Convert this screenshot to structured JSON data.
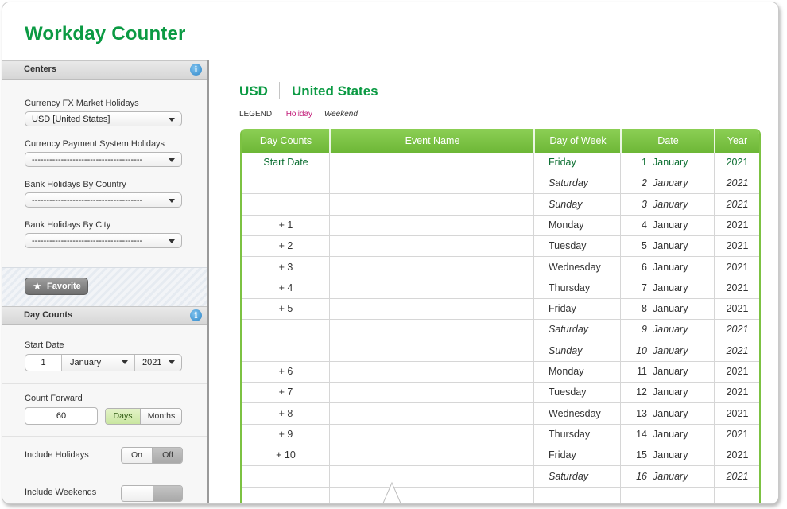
{
  "app": {
    "title": "Workday Counter"
  },
  "centers": {
    "title": "Centers",
    "info": "i",
    "fields": [
      {
        "label": "Currency FX Market Holidays",
        "value": "USD [United States]"
      },
      {
        "label": "Currency Payment System Holidays",
        "value": "--------------------------------------"
      },
      {
        "label": "Bank Holidays By Country",
        "value": "--------------------------------------"
      },
      {
        "label": "Bank Holidays By City",
        "value": "--------------------------------------"
      }
    ],
    "favorite_label": "Favorite"
  },
  "day_counts": {
    "title": "Day Counts",
    "info": "i",
    "start_date_label": "Start Date",
    "start_day": "1",
    "start_month": "January",
    "start_year": "2021",
    "count_forward_label": "Count Forward",
    "count_forward_value": "60",
    "unit_days": "Days",
    "unit_months": "Months",
    "include_holidays_label": "Include Holidays",
    "include_holidays_on": "On",
    "include_holidays_off": "Off",
    "include_weekends_label": "Include Weekends"
  },
  "main": {
    "currency_code": "USD",
    "currency_name": "United States",
    "legend_label": "LEGEND:",
    "legend_holiday": "Holiday",
    "legend_weekend": "Weekend",
    "columns": [
      "Day Counts",
      "Event Name",
      "Day of Week",
      "Date",
      "Year"
    ],
    "rows": [
      {
        "count": "Start Date",
        "event": "",
        "dow": "Friday",
        "day": "1",
        "month": "January",
        "year": "2021",
        "weekend": false,
        "start": true
      },
      {
        "count": "",
        "event": "",
        "dow": "Saturday",
        "day": "2",
        "month": "January",
        "year": "2021",
        "weekend": true
      },
      {
        "count": "",
        "event": "",
        "dow": "Sunday",
        "day": "3",
        "month": "January",
        "year": "2021",
        "weekend": true
      },
      {
        "count": "+ 1",
        "event": "",
        "dow": "Monday",
        "day": "4",
        "month": "January",
        "year": "2021",
        "weekend": false
      },
      {
        "count": "+ 2",
        "event": "",
        "dow": "Tuesday",
        "day": "5",
        "month": "January",
        "year": "2021",
        "weekend": false
      },
      {
        "count": "+ 3",
        "event": "",
        "dow": "Wednesday",
        "day": "6",
        "month": "January",
        "year": "2021",
        "weekend": false
      },
      {
        "count": "+ 4",
        "event": "",
        "dow": "Thursday",
        "day": "7",
        "month": "January",
        "year": "2021",
        "weekend": false
      },
      {
        "count": "+ 5",
        "event": "",
        "dow": "Friday",
        "day": "8",
        "month": "January",
        "year": "2021",
        "weekend": false
      },
      {
        "count": "",
        "event": "",
        "dow": "Saturday",
        "day": "9",
        "month": "January",
        "year": "2021",
        "weekend": true
      },
      {
        "count": "",
        "event": "",
        "dow": "Sunday",
        "day": "10",
        "month": "January",
        "year": "2021",
        "weekend": true
      },
      {
        "count": "+ 6",
        "event": "",
        "dow": "Monday",
        "day": "11",
        "month": "January",
        "year": "2021",
        "weekend": false
      },
      {
        "count": "+ 7",
        "event": "",
        "dow": "Tuesday",
        "day": "12",
        "month": "January",
        "year": "2021",
        "weekend": false
      },
      {
        "count": "+ 8",
        "event": "",
        "dow": "Wednesday",
        "day": "13",
        "month": "January",
        "year": "2021",
        "weekend": false
      },
      {
        "count": "+ 9",
        "event": "",
        "dow": "Thursday",
        "day": "14",
        "month": "January",
        "year": "2021",
        "weekend": false
      },
      {
        "count": "+ 10",
        "event": "",
        "dow": "Friday",
        "day": "15",
        "month": "January",
        "year": "2021",
        "weekend": false
      },
      {
        "count": "",
        "event": "",
        "dow": "Saturday",
        "day": "16",
        "month": "January",
        "year": "2021",
        "weekend": true
      }
    ]
  },
  "colors": {
    "brand_green": "#0b9a43",
    "header_green": "#7cc242",
    "holiday_magenta": "#c21b78",
    "info_blue": "#2f86c8"
  }
}
